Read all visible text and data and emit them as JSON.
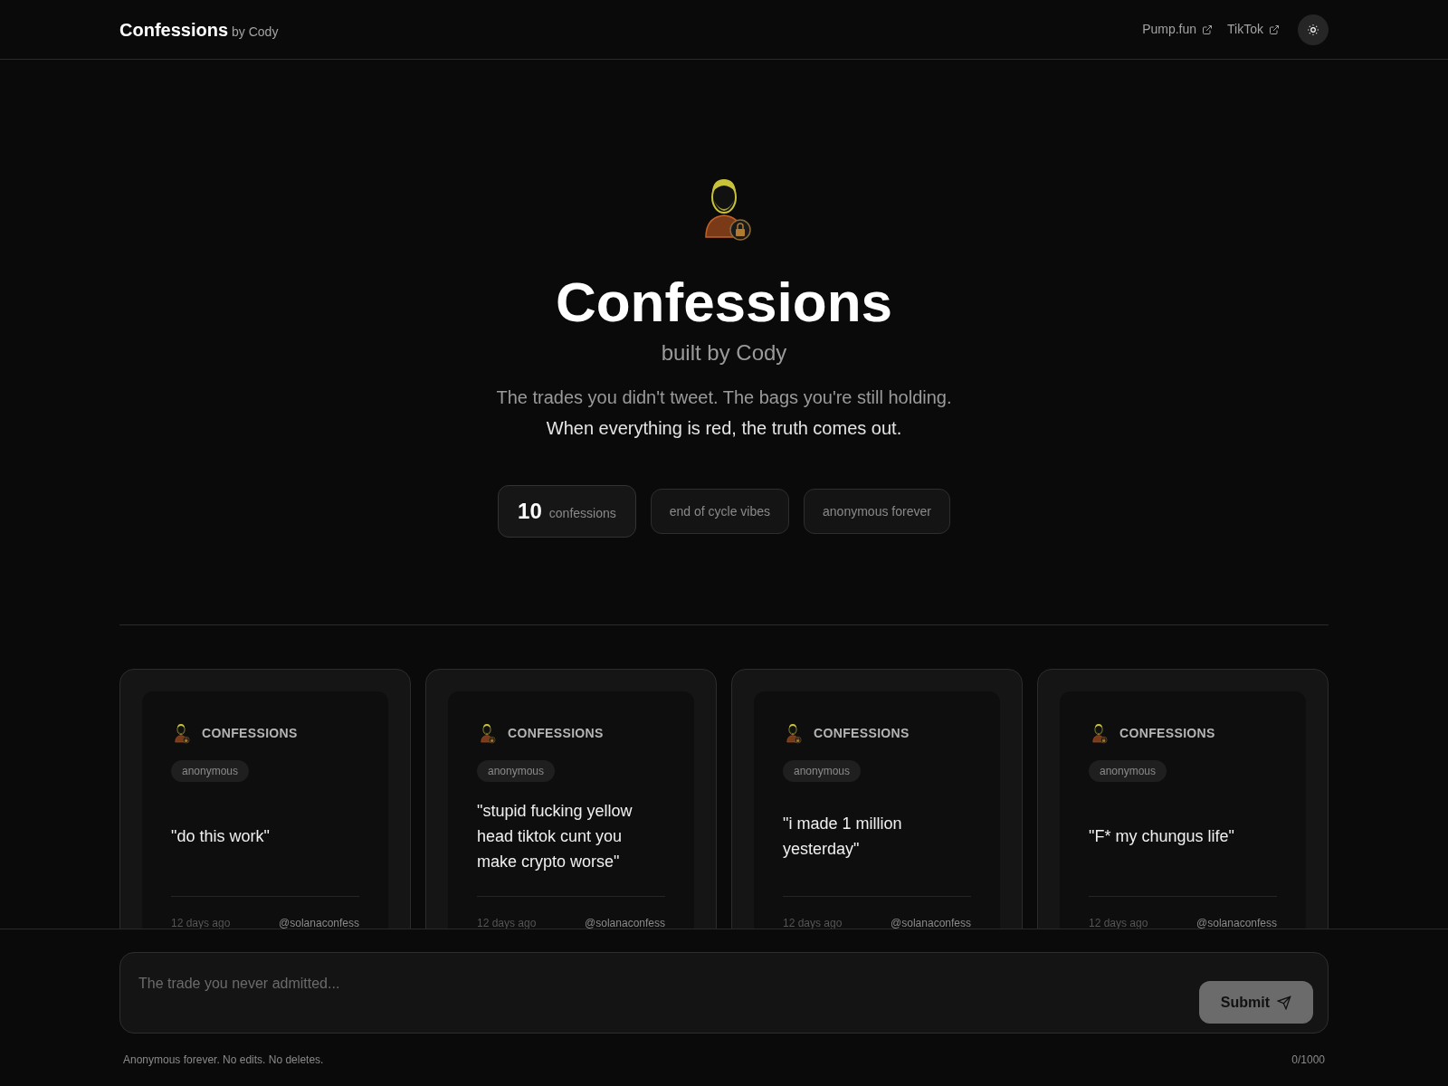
{
  "header": {
    "brand": "Confessions",
    "byline": "by Cody",
    "links": [
      {
        "label": "Pump.fun"
      },
      {
        "label": "TikTok"
      }
    ]
  },
  "hero": {
    "title": "Confessions",
    "subtitle": "built by Cody",
    "tagline": "The trades you didn't tweet. The bags you're still holding.",
    "tagline_strong": "When everything is red, the truth comes out.",
    "stats": [
      {
        "kind": "count",
        "value": "10",
        "label": "confessions"
      },
      {
        "kind": "pill",
        "label": "end of cycle vibes"
      },
      {
        "kind": "pill",
        "label": "anonymous forever"
      }
    ]
  },
  "cards": [
    {
      "brand": "CONFESSIONS",
      "tag": "anonymous",
      "text": "\"do this work\"",
      "time": "12 days ago",
      "handle": "@solanaconfess"
    },
    {
      "brand": "CONFESSIONS",
      "tag": "anonymous",
      "text": "\"stupid fucking yellow head tiktok cunt you make crypto worse\"",
      "time": "12 days ago",
      "handle": "@solanaconfess"
    },
    {
      "brand": "CONFESSIONS",
      "tag": "anonymous",
      "text": "\"i made 1 million yesterday\"",
      "time": "12 days ago",
      "handle": "@solanaconfess"
    },
    {
      "brand": "CONFESSIONS",
      "tag": "anonymous",
      "text": "\"F* my chungus life\"",
      "time": "12 days ago",
      "handle": "@solanaconfess"
    }
  ],
  "composer": {
    "placeholder": "The trade you never admitted...",
    "submit": "Submit",
    "note": "Anonymous forever. No edits. No deletes.",
    "counter": "0/1000"
  }
}
